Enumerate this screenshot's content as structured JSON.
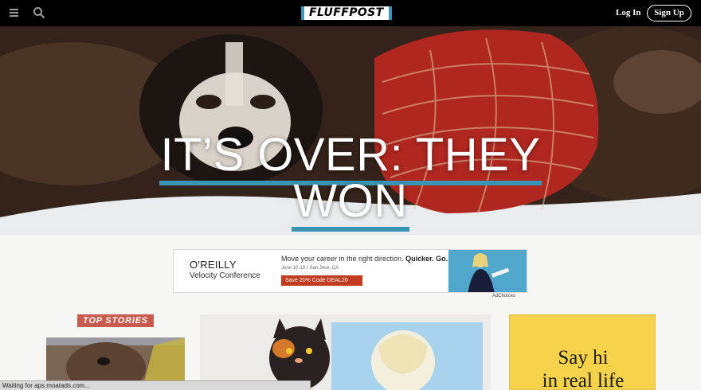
{
  "nav": {
    "logo": "FLUFFPOST",
    "login": "Log In",
    "signup": "Sign Up"
  },
  "icons": {
    "menu": "hamburger-icon",
    "search": "search-icon"
  },
  "hero": {
    "headline_line1": "IT’S OVER: THEY",
    "headline_line2": "WON"
  },
  "ad": {
    "brand": "O'REILLY",
    "subtitle": "Velocity Conference",
    "tagline": "Move your career in the right direction.",
    "tagline_bold": "Quicker. Go.",
    "dates": "June 10-13 • San Jose, CA",
    "cta": "Save 20% Code DEAL20",
    "adchoices": "AdChoices"
  },
  "sections": {
    "top_stories": "TOP STORIES"
  },
  "side_ad": {
    "line1": "Say hi",
    "line2": "in real life"
  },
  "status": "Waiting for aps.moatads.com...",
  "colors": {
    "accent": "#3a94b3",
    "nav_bg": "#000000",
    "label_red": "#c85a4e",
    "side_ad_yellow": "#f5d24a"
  }
}
